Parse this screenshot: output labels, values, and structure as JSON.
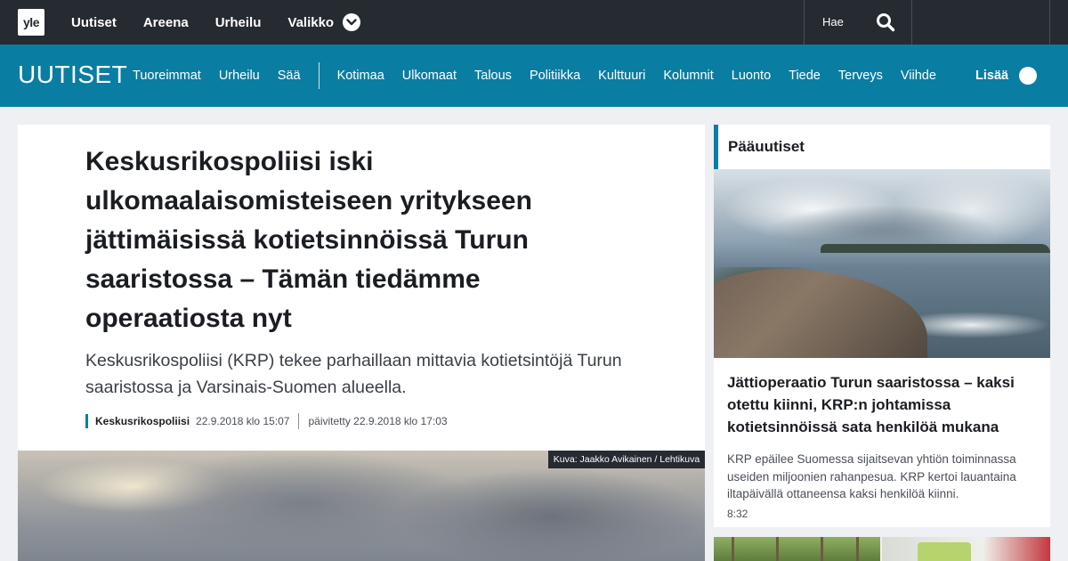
{
  "topbar": {
    "logo": "yle",
    "nav": [
      "Uutiset",
      "Areena",
      "Urheilu",
      "Valikko"
    ],
    "search_label": "Hae",
    "search_icon": "search-icon",
    "menu_icon": "chevron-down-icon"
  },
  "bluebar": {
    "brand": "UUTISET",
    "primary": [
      "Tuoreimmat",
      "Urheilu",
      "Sää"
    ],
    "secondary": [
      "Kotimaa",
      "Ulkomaat",
      "Talous",
      "Politiikka",
      "Kulttuuri",
      "Kolumnit",
      "Luonto",
      "Tiede",
      "Terveys",
      "Viihde"
    ],
    "more_label": "Lisää"
  },
  "article": {
    "headline": "Keskusrikospoliisi iski ulkomaalaisomisteiseen yritykseen jättimäisissä kotietsinnöissä Turun saaristossa – Tämän tiedämme operaatiosta nyt",
    "lead": "Keskusrikospoliisi (KRP) tekee parhaillaan mittavia kotietsintöjä Turun saaristossa ja Varsinais-Suomen alueella.",
    "category": "Keskusrikospoliisi",
    "published": "22.9.2018 klo 15:07",
    "updated": "päivitetty 22.9.2018 klo 17:03",
    "image_credit": "Kuva: Jaakko Avikainen / Lehtikuva"
  },
  "sidebar": {
    "heading": "Pääuutiset",
    "story": {
      "headline": "Jättioperaatio Turun saaristossa – kaksi otettu kiinni, KRP:n johtamissa kotietsinnöissä sata henkilöä mukana",
      "summary": "KRP epäilee Suomessa sijaitsevan yhtiön toiminnassa useiden miljoonien rahanpesua. KRP kertoi lauantaina iltapäivällä ottaneensa kaksi henkilöä kiinni.",
      "time": "8:32"
    }
  },
  "colors": {
    "topbar": "#262a31",
    "accent_blue": "#0a7da2",
    "background": "#eef0f3"
  }
}
